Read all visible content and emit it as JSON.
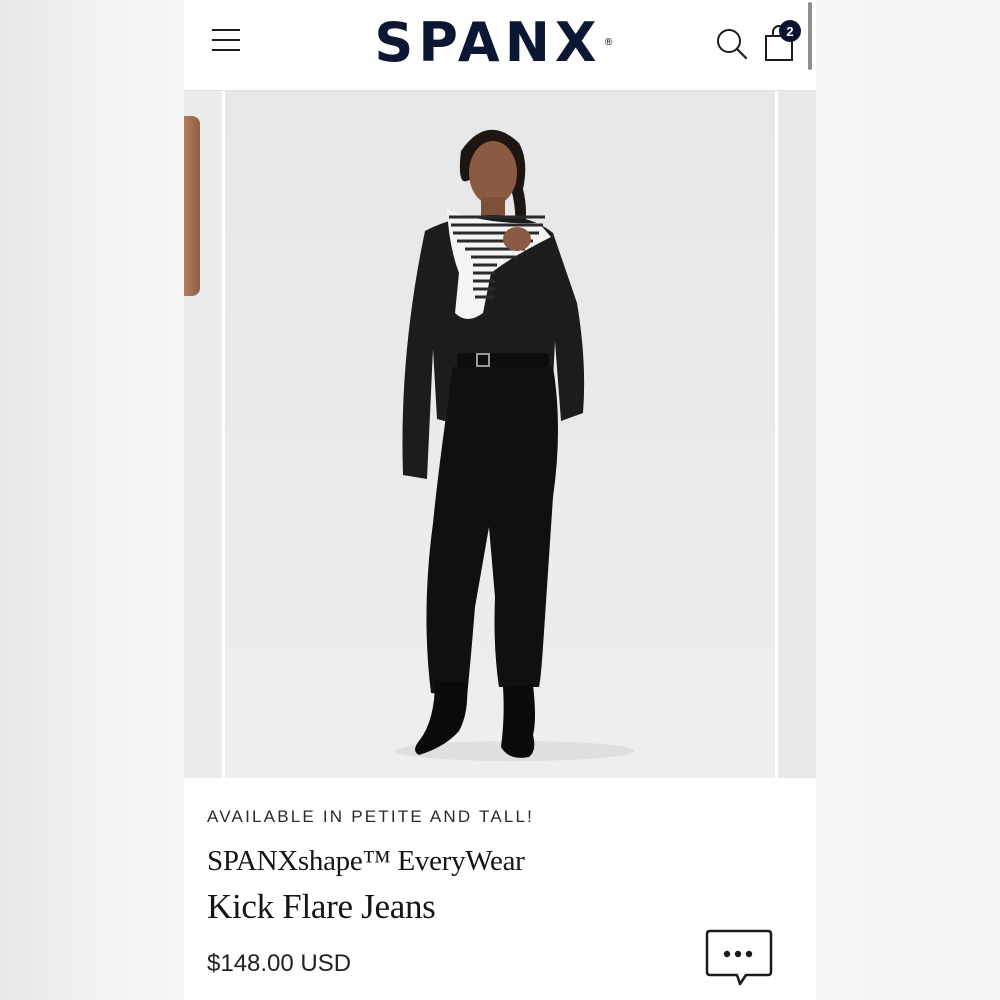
{
  "header": {
    "brand": "SPANX",
    "registered_mark": "®",
    "cart_count": "2",
    "icons": {
      "menu": "hamburger-menu-icon",
      "search": "search-icon",
      "cart": "shopping-bag-icon"
    }
  },
  "product": {
    "availability_note": "AVAILABLE IN PETITE AND TALL!",
    "collection": "SPANXshape™ EveryWear",
    "name": "Kick Flare Jeans",
    "price": "$148.00 USD"
  },
  "carousel": {
    "current_image": "model-full-length-photo"
  },
  "chat": {
    "icon": "chat-bubble-icon"
  },
  "colors": {
    "brand_navy": "#0c1734",
    "badge_bg": "#0b1330",
    "text_dark": "#151515"
  }
}
